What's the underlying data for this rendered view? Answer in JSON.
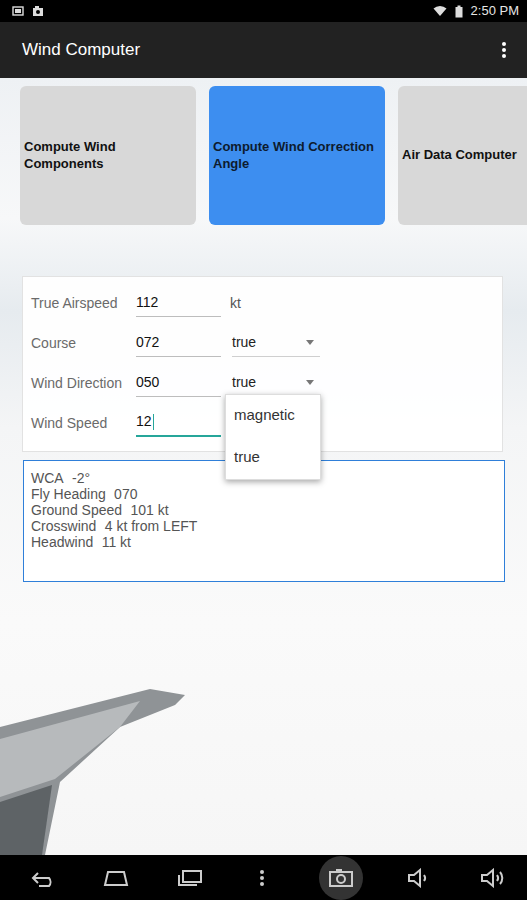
{
  "status_bar": {
    "time": "2:50 PM"
  },
  "app_bar": {
    "title": "Wind Computer"
  },
  "tabs": [
    {
      "label": "Compute Wind Components",
      "selected": false
    },
    {
      "label": "Compute Wind Correction Angle",
      "selected": true
    },
    {
      "label": "Air Data Computer",
      "selected": false
    }
  ],
  "form": {
    "fields": [
      {
        "label": "True Airspeed",
        "value": "112",
        "kind": "unit",
        "unit": "kt",
        "focused": false,
        "menu_open": false
      },
      {
        "label": "Course",
        "value": "072",
        "kind": "select",
        "reference": "true",
        "focused": false,
        "menu_open": false
      },
      {
        "label": "Wind Direction",
        "value": "050",
        "kind": "select",
        "reference": "true",
        "focused": false,
        "menu_open": true
      },
      {
        "label": "Wind Speed",
        "value": "12",
        "kind": "plain",
        "focused": true,
        "menu_open": false
      }
    ]
  },
  "dropdown_menu": {
    "options": [
      "magnetic",
      "true"
    ]
  },
  "results": [
    {
      "label": "WCA",
      "value": "-2°"
    },
    {
      "label": "Fly Heading",
      "value": "070"
    },
    {
      "label": "Ground Speed",
      "value": "101 kt"
    },
    {
      "label": "Crosswind",
      "value": "4 kt from LEFT"
    },
    {
      "label": "Headwind",
      "value": "11 kt"
    }
  ]
}
